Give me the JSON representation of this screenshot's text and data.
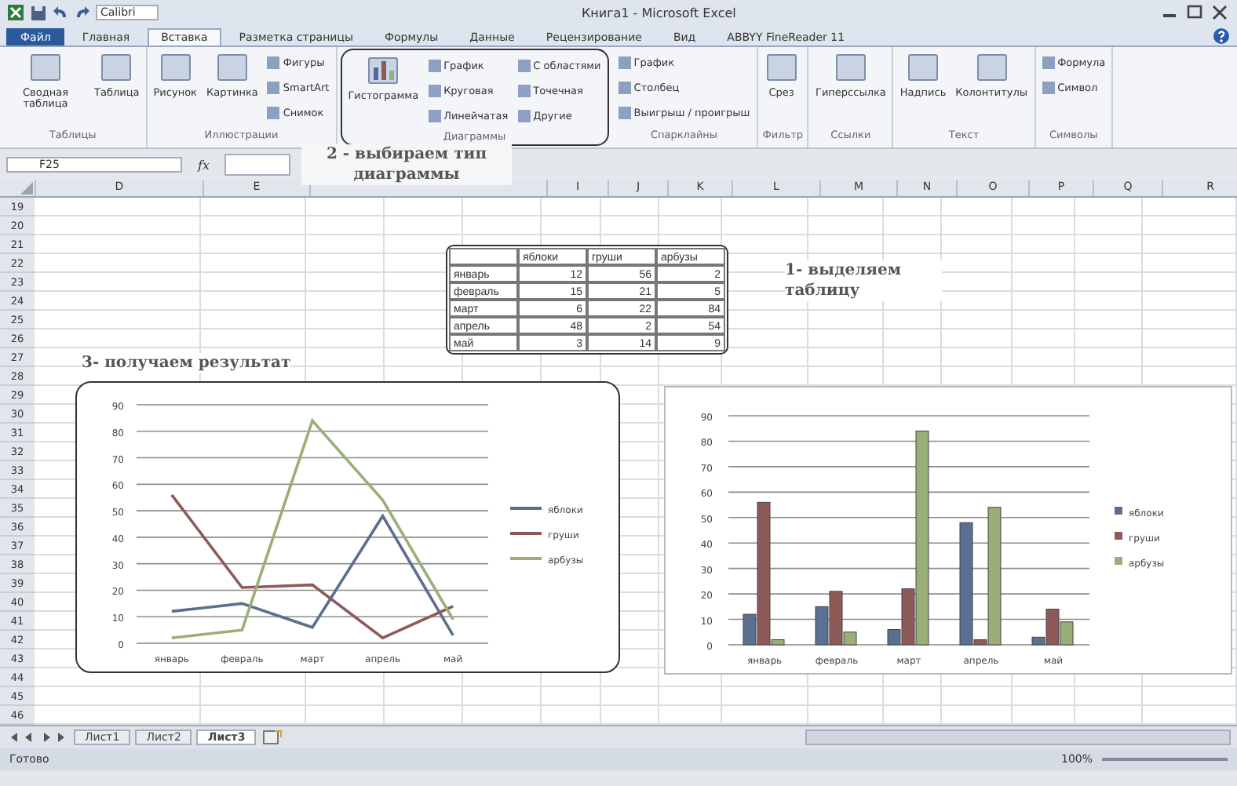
{
  "window": {
    "title": "Книга1 - Microsoft Excel",
    "quick_font": "Calibri"
  },
  "tabs": [
    {
      "label": "Файл",
      "selected": false,
      "kind": "file"
    },
    {
      "label": "Главная",
      "selected": false,
      "kind": "tab"
    },
    {
      "label": "Вставка",
      "selected": true,
      "kind": "tab"
    },
    {
      "label": "Разметка страницы",
      "selected": false,
      "kind": "tab"
    },
    {
      "label": "Формулы",
      "selected": false,
      "kind": "tab"
    },
    {
      "label": "Данные",
      "selected": false,
      "kind": "tab"
    },
    {
      "label": "Рецензирование",
      "selected": false,
      "kind": "tab"
    },
    {
      "label": "Вид",
      "selected": false,
      "kind": "tab"
    },
    {
      "label": "ABBYY FineReader 11",
      "selected": false,
      "kind": "tab"
    }
  ],
  "ribbon": {
    "groups": [
      {
        "name": "Таблицы",
        "highlighted": false,
        "buttons": [
          {
            "label": "Сводная таблица",
            "kind": "large"
          },
          {
            "label": "Таблица",
            "kind": "large"
          }
        ]
      },
      {
        "name": "Иллюстрации",
        "highlighted": false,
        "buttons": [
          {
            "label": "Рисунок",
            "kind": "large"
          },
          {
            "label": "Картинка",
            "kind": "large"
          },
          {
            "label": "Фигуры",
            "kind": "small"
          },
          {
            "label": "SmartArt",
            "kind": "small"
          },
          {
            "label": "Снимок",
            "kind": "small"
          }
        ]
      },
      {
        "name": "Диаграммы",
        "highlighted": true,
        "buttons": [
          {
            "label": "Гистограмма",
            "kind": "large"
          },
          {
            "label": "График",
            "kind": "small"
          },
          {
            "label": "Круговая",
            "kind": "small"
          },
          {
            "label": "Линейчатая",
            "kind": "small"
          },
          {
            "label": "С областями",
            "kind": "small"
          },
          {
            "label": "Точечная",
            "kind": "small"
          },
          {
            "label": "Другие",
            "kind": "small"
          }
        ]
      },
      {
        "name": "Спарклайны",
        "highlighted": false,
        "buttons": [
          {
            "label": "График",
            "kind": "small"
          },
          {
            "label": "Столбец",
            "kind": "small"
          },
          {
            "label": "Выигрыш / проигрыш",
            "kind": "small"
          }
        ]
      },
      {
        "name": "Фильтр",
        "highlighted": false,
        "buttons": [
          {
            "label": "Срез",
            "kind": "large"
          }
        ]
      },
      {
        "name": "Ссылки",
        "highlighted": false,
        "buttons": [
          {
            "label": "Гиперссылка",
            "kind": "large"
          }
        ]
      },
      {
        "name": "Текст",
        "highlighted": false,
        "buttons": [
          {
            "label": "Надпись",
            "kind": "large"
          },
          {
            "label": "Колонтитулы",
            "kind": "large"
          }
        ]
      },
      {
        "name": "Символы",
        "highlighted": false,
        "buttons": [
          {
            "label": "Формула",
            "kind": "small"
          },
          {
            "label": "Символ",
            "kind": "small"
          }
        ]
      }
    ]
  },
  "name_box": "F25",
  "formula_icon": "fx",
  "columns": [
    "D",
    "E",
    "I",
    "J",
    "K",
    "L",
    "M",
    "N",
    "O",
    "P",
    "Q",
    "R"
  ],
  "rows": [
    "19",
    "20",
    "21",
    "22",
    "23",
    "24",
    "25",
    "26",
    "27",
    "28",
    "29",
    "30",
    "31",
    "32",
    "33",
    "34",
    "35",
    "36",
    "37",
    "38",
    "39",
    "40",
    "41",
    "42",
    "43",
    "44",
    "45",
    "46"
  ],
  "notes": [
    {
      "text": "1- выделяем таблицу"
    },
    {
      "text": "2 - выбираем тип диаграммы"
    },
    {
      "text": "3- получаем результат"
    }
  ],
  "data_table": {
    "columns": [
      "яблоки",
      "груши",
      "арбузы"
    ],
    "rows": [
      {
        "label": "январь",
        "cells": [
          "12",
          "56",
          "2"
        ]
      },
      {
        "label": "февраль",
        "cells": [
          "15",
          "21",
          "5"
        ]
      },
      {
        "label": "март",
        "cells": [
          "6",
          "22",
          "84"
        ]
      },
      {
        "label": "апрель",
        "cells": [
          "48",
          "2",
          "54"
        ]
      },
      {
        "label": "май",
        "cells": [
          "3",
          "14",
          "9"
        ]
      }
    ]
  },
  "line_chart": {
    "chart_data": {
      "type": "line",
      "grid": true,
      "legend": true,
      "categories": [
        "январь",
        "февраль",
        "март",
        "апрель",
        "май"
      ],
      "ylim": [
        0,
        90
      ],
      "yticks": [
        0,
        10,
        20,
        30,
        40,
        50,
        60,
        70,
        80,
        90
      ],
      "series": [
        {
          "name": "яблоки",
          "color": "#5b6f90",
          "values": [
            12,
            15,
            6,
            48,
            3
          ]
        },
        {
          "name": "груши",
          "color": "#8e5a58",
          "values": [
            56,
            21,
            22,
            2,
            14
          ]
        },
        {
          "name": "арбузы",
          "color": "#9aae78",
          "values": [
            2,
            5,
            84,
            54,
            9
          ]
        }
      ]
    }
  },
  "bar_chart": {
    "chart_data": {
      "type": "bar",
      "grid": true,
      "legend": true,
      "categories": [
        "январь",
        "февраль",
        "март",
        "апрель",
        "май"
      ],
      "ylim": [
        0,
        90
      ],
      "yticks": [
        0,
        10,
        20,
        30,
        40,
        50,
        60,
        70,
        80,
        90
      ],
      "series": [
        {
          "name": "яблоки",
          "color": "#5b6f90",
          "values": [
            12,
            15,
            6,
            48,
            3
          ]
        },
        {
          "name": "груши",
          "color": "#8e5a58",
          "values": [
            56,
            21,
            22,
            2,
            14
          ]
        },
        {
          "name": "арбузы",
          "color": "#9aae78",
          "values": [
            2,
            5,
            84,
            54,
            9
          ]
        }
      ]
    }
  },
  "sheets": [
    {
      "label": "Лист1",
      "selected": false
    },
    {
      "label": "Лист2",
      "selected": false
    },
    {
      "label": "Лист3",
      "selected": true
    }
  ],
  "status_bar": {
    "text": "Готово",
    "zoom": "100%"
  }
}
